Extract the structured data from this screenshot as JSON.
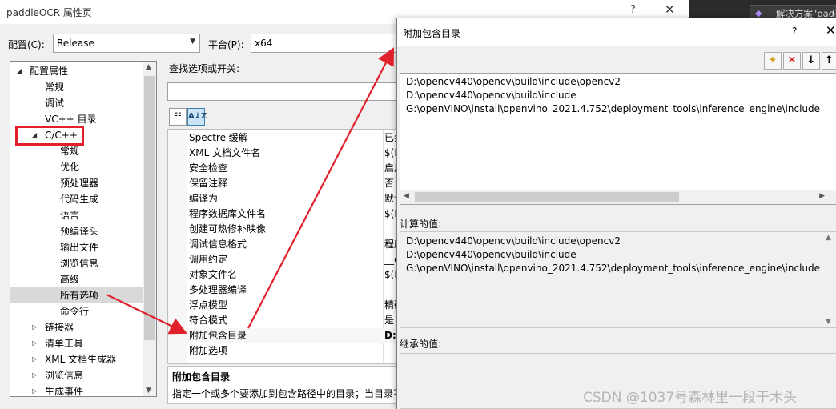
{
  "main_window": {
    "title": "paddleOCR 属性页",
    "help_glyph": "?",
    "close_glyph": "✕"
  },
  "taskbar": {
    "tab_label": "解决方案\"padd"
  },
  "toolbar": {
    "config_label": "配置(C):",
    "config_value": "Release",
    "platform_label": "平台(P):",
    "platform_value": "x64"
  },
  "tree": {
    "items": [
      {
        "label": "配置属性",
        "indent": 0,
        "expander": "◢"
      },
      {
        "label": "常规",
        "indent": 1
      },
      {
        "label": "调试",
        "indent": 1
      },
      {
        "label": "VC++ 目录",
        "indent": 1
      },
      {
        "label": "C/C++",
        "indent": 1,
        "expander": "◢"
      },
      {
        "label": "常规",
        "indent": 2
      },
      {
        "label": "优化",
        "indent": 2
      },
      {
        "label": "预处理器",
        "indent": 2
      },
      {
        "label": "代码生成",
        "indent": 2
      },
      {
        "label": "语言",
        "indent": 2
      },
      {
        "label": "预编译头",
        "indent": 2
      },
      {
        "label": "输出文件",
        "indent": 2
      },
      {
        "label": "浏览信息",
        "indent": 2
      },
      {
        "label": "高级",
        "indent": 2
      },
      {
        "label": "所有选项",
        "indent": 2,
        "selected": true
      },
      {
        "label": "命令行",
        "indent": 2
      },
      {
        "label": "链接器",
        "indent": 1,
        "expander": "▷"
      },
      {
        "label": "清单工具",
        "indent": 1,
        "expander": "▷"
      },
      {
        "label": "XML 文档生成器",
        "indent": 1,
        "expander": "▷"
      },
      {
        "label": "浏览信息",
        "indent": 1,
        "expander": "▷"
      },
      {
        "label": "生成事件",
        "indent": 1,
        "expander": "▷"
      }
    ]
  },
  "search": {
    "label": "查找选项或开关:"
  },
  "sort_buttons": {
    "categorized": "☷",
    "alphabetical": "A↓Z"
  },
  "grid": {
    "rows": [
      {
        "key": "Spectre 缓解",
        "value": "已禁"
      },
      {
        "key": "XML 文档文件名",
        "value": "$(I"
      },
      {
        "key": "安全检查",
        "value": "启用"
      },
      {
        "key": "保留注释",
        "value": "否"
      },
      {
        "key": "编译为",
        "value": "默认"
      },
      {
        "key": "程序数据库文件名",
        "value": "$(I"
      },
      {
        "key": "创建可热修补映像",
        "value": ""
      },
      {
        "key": "调试信息格式",
        "value": "程序"
      },
      {
        "key": "调用约定",
        "value": "__c"
      },
      {
        "key": "对象文件名",
        "value": "$(I"
      },
      {
        "key": "多处理器编译",
        "value": ""
      },
      {
        "key": "浮点模型",
        "value": "精确"
      },
      {
        "key": "符合模式",
        "value": "是"
      },
      {
        "key": "附加包含目录",
        "value": "D:\\",
        "highlight": true
      },
      {
        "key": "附加选项",
        "value": ""
      }
    ]
  },
  "description": {
    "heading": "附加包含目录",
    "body": "指定一个或多个要添加到包含路径中的目录；当目录不"
  },
  "dialog": {
    "title": "附加包含目录",
    "help_glyph": "?",
    "close_glyph": "✕",
    "buttons": {
      "new_line": "✦",
      "delete": "✕",
      "down": "↓",
      "up": "↑"
    },
    "entries": [
      "D:\\opencv440\\opencv\\build\\include\\opencv2",
      "D:\\opencv440\\opencv\\build\\include",
      "G:\\openVINO\\install\\openvino_2021.4.752\\deployment_tools\\inference_engine\\include"
    ],
    "computed_label": "计算的值:",
    "computed_values": [
      "D:\\opencv440\\opencv\\build\\include\\opencv2",
      "D:\\opencv440\\opencv\\build\\include",
      "G:\\openVINO\\install\\openvino_2021.4.752\\deployment_tools\\inference_engine\\include"
    ],
    "inherited_label": "继承的值:"
  },
  "watermark": "CSDN @1037号森林里一段干木头",
  "colors": {
    "annotation_red": "#e0202a",
    "selection_gray": "#d9d9d9",
    "window_bg": "#f0f0f0"
  }
}
